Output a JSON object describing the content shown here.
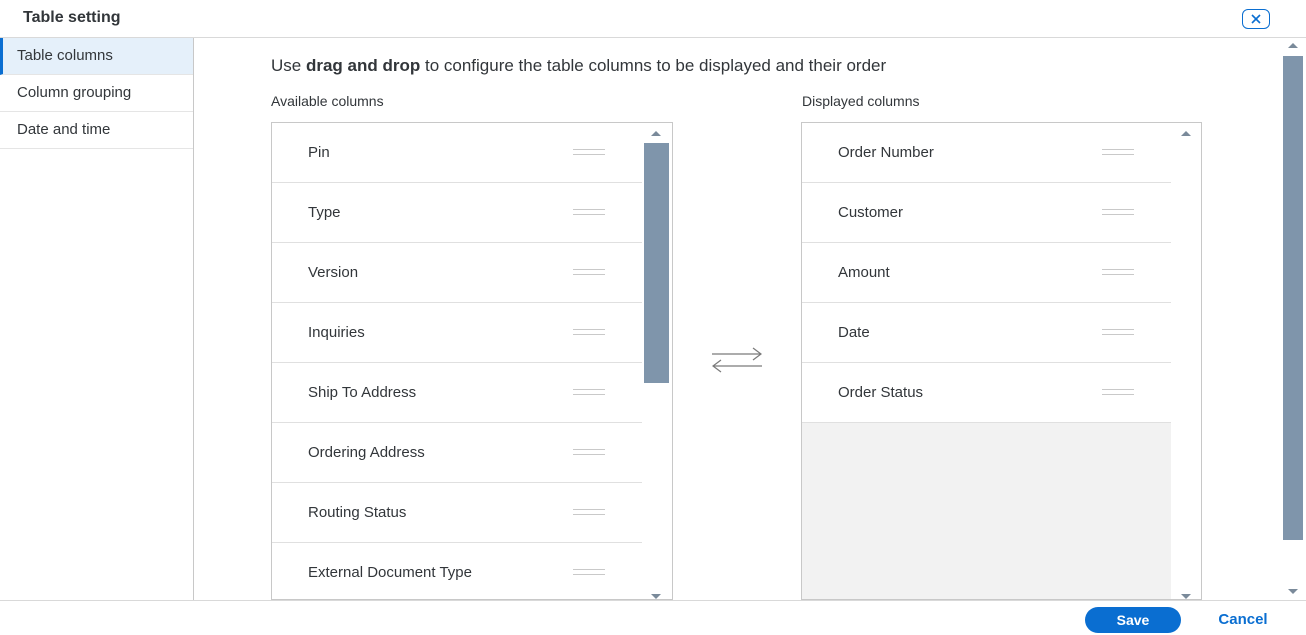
{
  "dialog": {
    "title": "Table setting"
  },
  "sidebar": {
    "items": [
      {
        "label": "Table columns",
        "active": true
      },
      {
        "label": "Column grouping",
        "active": false
      },
      {
        "label": "Date and time",
        "active": false
      }
    ]
  },
  "main": {
    "instruction_prefix": "Use ",
    "instruction_bold": "drag and drop",
    "instruction_suffix": " to configure the table columns to be displayed and their order",
    "available_label": "Available columns",
    "displayed_label": "Displayed columns",
    "available_columns": [
      "Pin",
      "Type",
      "Version",
      "Inquiries",
      "Ship To Address",
      "Ordering Address",
      "Routing Status",
      "External Document Type"
    ],
    "displayed_columns": [
      "Order Number",
      "Customer",
      "Amount",
      "Date",
      "Order Status"
    ]
  },
  "footer": {
    "save_label": "Save",
    "cancel_label": "Cancel"
  },
  "colors": {
    "accent": "#0a6ed1",
    "selected_bg": "#e5f0fa",
    "scroll_thumb": "#7f95ab"
  },
  "icons": {
    "close": "close-icon",
    "swap": "swap-arrows-icon",
    "handle": "drag-handle-icon"
  }
}
